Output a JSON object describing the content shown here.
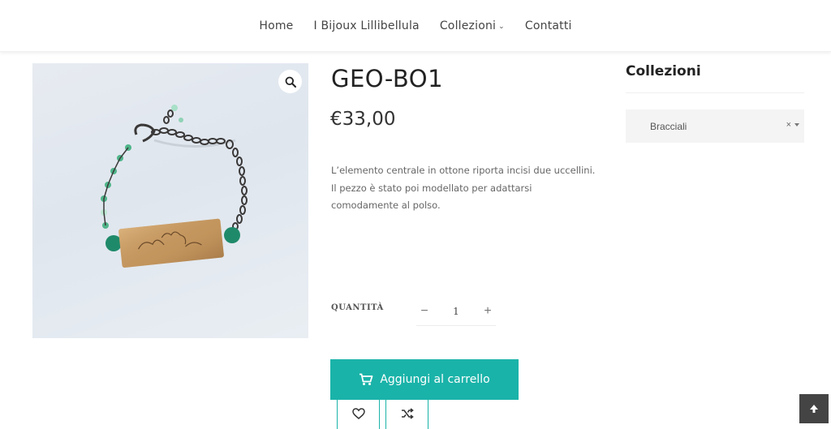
{
  "nav": {
    "items": [
      {
        "label": "Home"
      },
      {
        "label": "I Bijoux Lillibellula"
      },
      {
        "label": "Collezioni",
        "has_dropdown": true
      },
      {
        "label": "Contatti"
      }
    ]
  },
  "product": {
    "title": "GEO-BO1",
    "price": "€33,00",
    "description": "L’elemento centrale in ottone riporta incisi due uccellini. Il pezzo è stato poi modellato per adattarsi comodamente al polso.",
    "quantity_label": "QUANTITÀ",
    "quantity_value": "1",
    "add_to_cart_label": "Aggiungi al carrello",
    "image_icon": "zoom-icon"
  },
  "sidebar": {
    "title": "Collezioni",
    "select_value": "Bracciali",
    "clear_symbol": "×"
  },
  "colors": {
    "accent": "#1ab3a9",
    "scroll_top_bg": "#444444"
  }
}
